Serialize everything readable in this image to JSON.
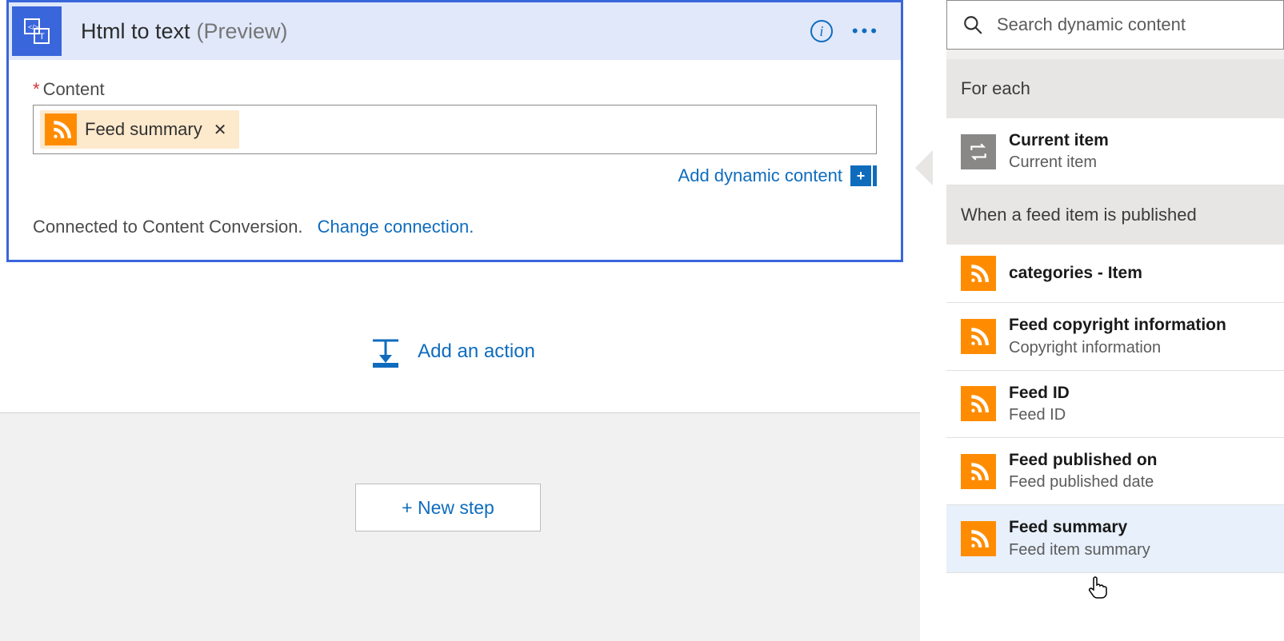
{
  "card": {
    "title": "Html to text",
    "subtitle": "(Preview)",
    "content_label": "Content",
    "token_label": "Feed summary",
    "add_dynamic": "Add dynamic content",
    "connected_text": "Connected to Content Conversion.",
    "change_connection": "Change connection."
  },
  "add_action": "Add an action",
  "new_step": "+ New step",
  "panel": {
    "search_placeholder": "Search dynamic content",
    "section_foreach": "For each",
    "current_item_title": "Current item",
    "current_item_sub": "Current item",
    "section_feed": "When a feed item is published",
    "items": [
      {
        "title": "categories - Item",
        "sub": ""
      },
      {
        "title": "Feed copyright information",
        "sub": "Copyright information"
      },
      {
        "title": "Feed ID",
        "sub": "Feed ID"
      },
      {
        "title": "Feed published on",
        "sub": "Feed published date"
      },
      {
        "title": "Feed summary",
        "sub": "Feed item summary"
      }
    ]
  }
}
